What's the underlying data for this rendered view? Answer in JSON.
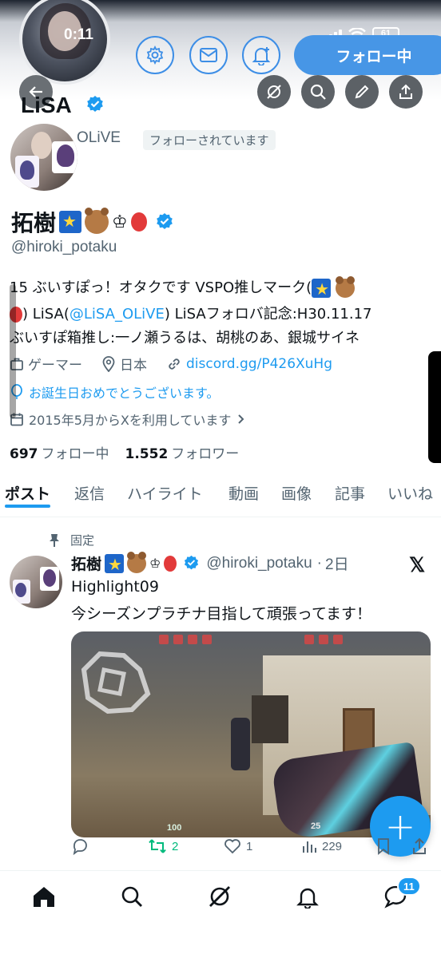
{
  "status_bar": {
    "time": "0:11",
    "battery": "61"
  },
  "header": {
    "follow_button": "フォロー中",
    "back_icon": "back-arrow-icon",
    "buttons": [
      "gear-icon",
      "mail-icon",
      "bell-plus-icon"
    ],
    "tools": [
      "grok-icon",
      "search-icon",
      "pencil-icon",
      "share-icon"
    ]
  },
  "related": {
    "name": "LiSA",
    "handle_fragment": "OLiVE",
    "follows_you_badge": "フォローされています"
  },
  "profile": {
    "display_name": "拓樹",
    "crown": "♔",
    "handle": "@hiroki_potaku",
    "bio_lines": [
      {
        "pre": "15 ぶいすぽっ！オタクです VSPO推しマーク(",
        "link": "",
        "post": ""
      },
      {
        "pre": ") LiSA(",
        "link": "@LiSA_OLiVE",
        "post": ") LiSAフォロバ記念:H30.11.17"
      },
      {
        "pre": "ぶいすぽ箱推し:一ノ瀬うるは、胡桃のあ、銀城サイネ",
        "link": "",
        "post": ""
      }
    ],
    "category": "ゲーマー",
    "location": "日本",
    "website": "discord.gg/P426XuHg",
    "birthday_text": "お誕生日おめでとうございます。",
    "joined": "2015年5月からXを利用しています",
    "following_count": "697",
    "following_label": "フォロー中",
    "followers_count": "1.552",
    "followers_label": "フォロワー"
  },
  "tabs": [
    "ポスト",
    "返信",
    "ハイライト",
    "動画",
    "画像",
    "記事",
    "いいね"
  ],
  "pinned_post": {
    "pinned_label": "固定",
    "name": "拓樹",
    "handle": "@hiroki_potaku",
    "time": "2日",
    "separator": "·",
    "line1": "Highlight09",
    "line2": "今シーズンプラチナ目指して頑張ってます！",
    "media_hud": {
      "hp": "100",
      "ammo": "25"
    },
    "retweets": "2",
    "likes": "1",
    "views": "229"
  },
  "fab_label": "+",
  "bottom_nav": {
    "items": [
      "home-icon",
      "search-icon",
      "grok-icon",
      "bell-icon",
      "messages-icon"
    ],
    "messages_badge": "11"
  },
  "colors": {
    "accent": "#1d9bf0",
    "retweet": "#00ba7c",
    "text_secondary": "#536471"
  }
}
